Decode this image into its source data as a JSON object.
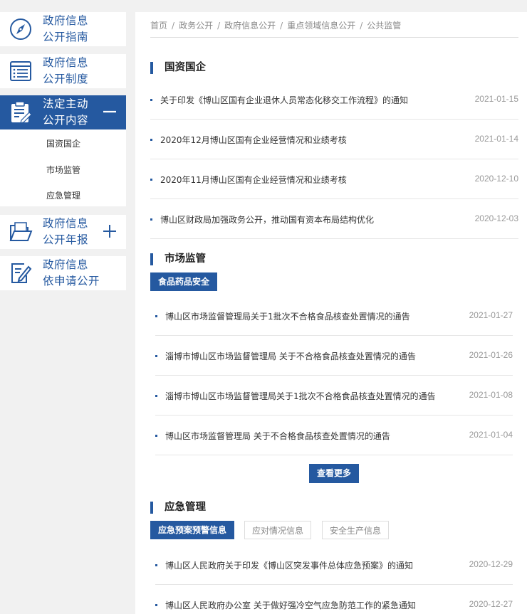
{
  "sidebar": {
    "items": [
      {
        "line1": "政府信息",
        "line2": "公开指南",
        "icon": "compass-icon"
      },
      {
        "line1": "政府信息",
        "line2": "公开制度",
        "icon": "list-document-icon"
      },
      {
        "line1": "法定主动",
        "line2": "公开内容",
        "icon": "clipboard-edit-icon",
        "expanded": true
      },
      {
        "line1": "政府信息",
        "line2": "公开年报",
        "icon": "folder-open-icon"
      },
      {
        "line1": "政府信息",
        "line2": "依申请公开",
        "icon": "edit-document-icon"
      }
    ],
    "sub_items": [
      "国资国企",
      "市场监管",
      "应急管理"
    ]
  },
  "breadcrumb": [
    "首页",
    "政务公开",
    "政府信息公开",
    "重点领域信息公开",
    "公共监管"
  ],
  "sections": {
    "gzgq": {
      "title": "国资国企",
      "rows": [
        {
          "title": "关于印发《博山区国有企业退休人员常态化移交工作流程》的通知",
          "date": "2021-01-15"
        },
        {
          "title": "2020年12月博山区国有企业经营情况和业绩考核",
          "date": "2021-01-14"
        },
        {
          "title": "2020年11月博山区国有企业经营情况和业绩考核",
          "date": "2020-12-10"
        },
        {
          "title": "博山区财政局加强政务公开，推动国有资本布局结构优化",
          "date": "2020-12-03"
        }
      ]
    },
    "scjg": {
      "title": "市场监管",
      "tabs": [
        "食品药品安全"
      ],
      "rows": [
        {
          "title": "博山区市场监督管理局关于1批次不合格食品核查处置情况的通告",
          "date": "2021-01-27"
        },
        {
          "title": "淄博市博山区市场监督管理局 关于不合格食品核查处置情况的通告",
          "date": "2021-01-26"
        },
        {
          "title": "淄博市博山区市场监督管理局关于1批次不合格食品核查处置情况的通告",
          "date": "2021-01-08"
        },
        {
          "title": "博山区市场监督管理局 关于不合格食品核查处置情况的通告",
          "date": "2021-01-04"
        }
      ],
      "more_label": "查看更多"
    },
    "yjgl": {
      "title": "应急管理",
      "tabs": [
        "应急预案预警信息",
        "应对情况信息",
        "安全生产信息"
      ],
      "rows": [
        {
          "title": "博山区人民政府关于印发《博山区突发事件总体应急预案》的通知",
          "date": "2020-12-29"
        },
        {
          "title": "博山区人民政府办公室 关于做好强冷空气应急防范工作的紧急通知",
          "date": "2020-12-27"
        }
      ]
    }
  },
  "colors": {
    "accent": "#2559a0",
    "background": "#f1f1f1"
  }
}
